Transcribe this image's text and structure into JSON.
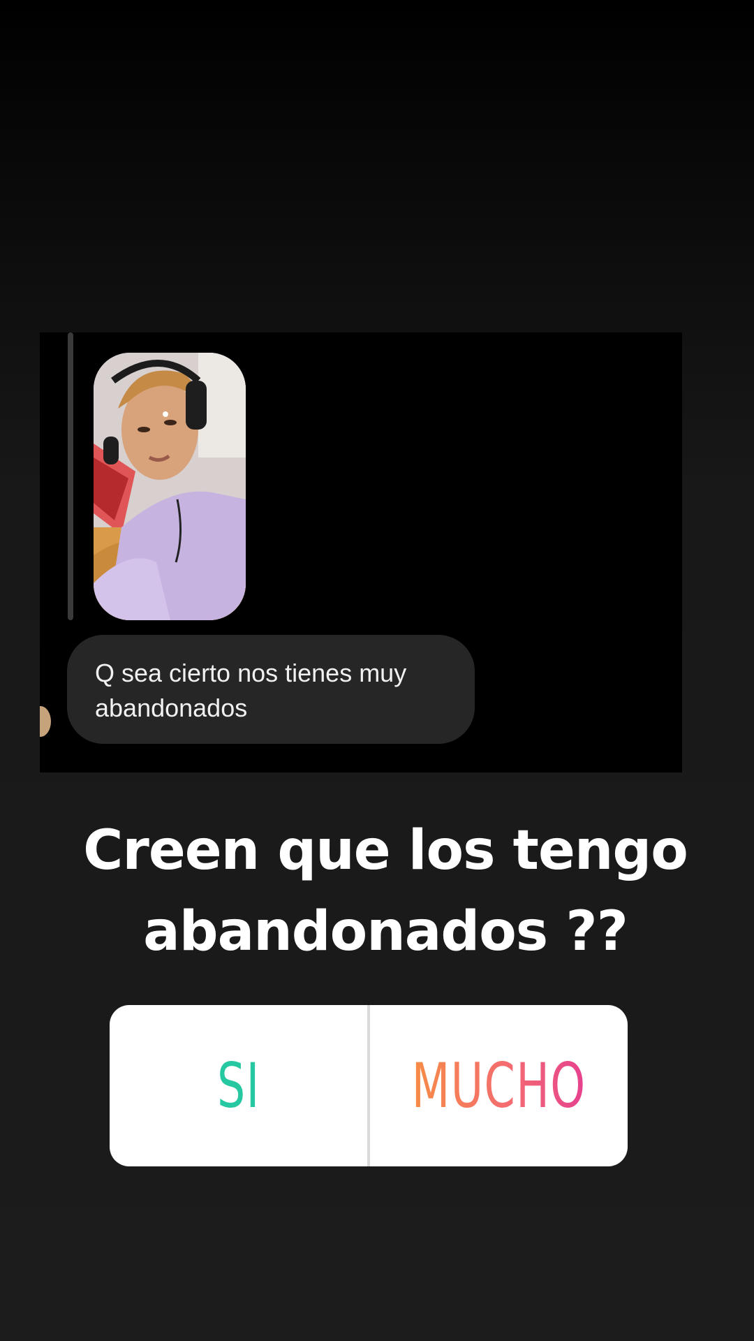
{
  "reply_card": {
    "message": "Q sea cierto nos tienes muy abandonados"
  },
  "question": {
    "line1": "Creen que los tengo",
    "line2": "abandonados ??"
  },
  "poll": {
    "option_1": "SI",
    "option_2": "MUCHO",
    "option_1_color": "#25c8a0",
    "option_2_gradient": [
      "#f78c45",
      "#f46c70",
      "#e6408f"
    ]
  },
  "colors": {
    "background": "#1c1c1c",
    "bubble": "#262626"
  }
}
